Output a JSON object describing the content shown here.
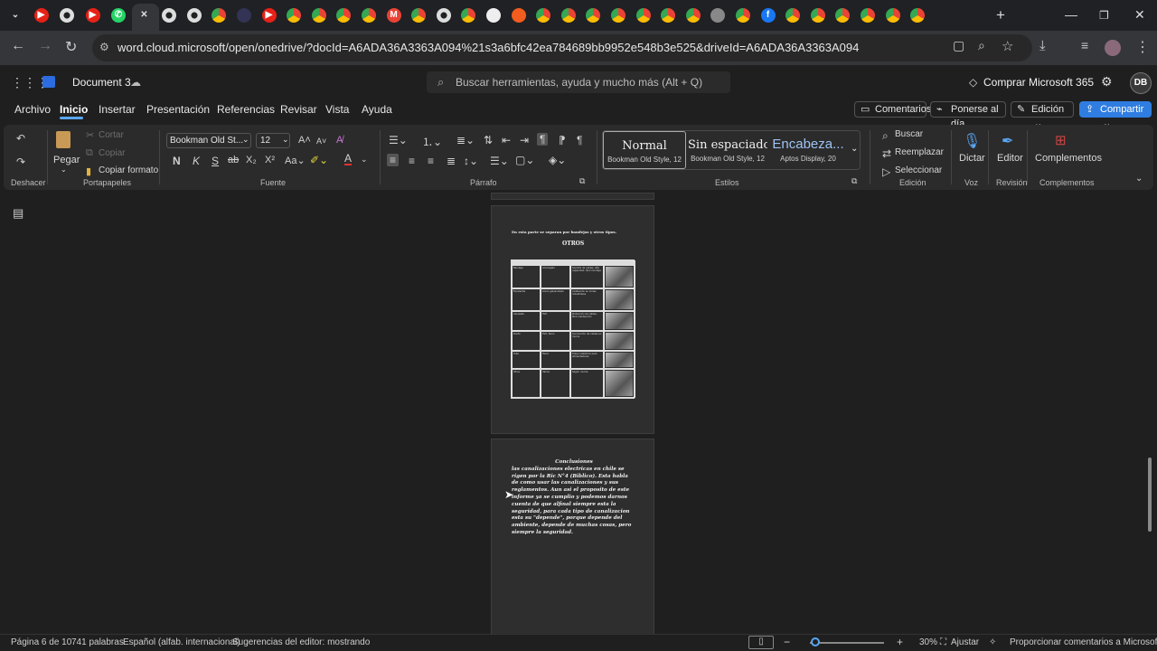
{
  "browser": {
    "url": "word.cloud.microsoft/open/onedrive/?docId=A6ADA36A3363A094%21s3a6bfc42ea784689bb9952e548b3e525&driveId=A6ADA36A3363A094",
    "new_tab": "+",
    "tab_icons": [
      "chevron-down-icon",
      "youtube-icon",
      "chatgpt-icon",
      "youtube-icon",
      "whatsapp-icon",
      "close-icon",
      "chatgpt-icon",
      "chatgpt-icon",
      "chrome-icon",
      "bcc-icon",
      "youtube-icon",
      "chrome-icon",
      "chrome-icon",
      "chrome-icon",
      "chrome-icon",
      "gmail-icon",
      "chrome-icon",
      "chatgpt-icon",
      "chrome-icon",
      "page-icon",
      "brave-icon",
      "chrome-icon",
      "chrome-icon",
      "chrome-icon",
      "chrome-icon",
      "chrome-icon",
      "chrome-icon",
      "chrome-icon",
      "globe-icon",
      "chrome-icon",
      "facebook-icon",
      "chrome-icon",
      "chrome-icon",
      "chrome-icon",
      "chrome-icon",
      "chrome-icon",
      "chrome-icon"
    ]
  },
  "word": {
    "doc_title": "Document 3",
    "search_placeholder": "Buscar herramientas, ayuda y mucho más (Alt + Q)",
    "buy_label": "Comprar Microsoft 365",
    "avatar": "DB",
    "menu": [
      "Archivo",
      "Inicio",
      "Insertar",
      "Presentación",
      "Referencias",
      "Revisar",
      "Vista",
      "Ayuda"
    ],
    "comments_btn": "Comentarios",
    "catchup_btn": "Ponerse al día",
    "edit_btn": "Edición",
    "share_btn": "Compartir"
  },
  "ribbon": {
    "undo_group": "Deshacer",
    "paste": "Pegar",
    "cut": "Cortar",
    "copy": "Copiar",
    "format_painter": "Copiar formato",
    "clipboard_group": "Portapapeles",
    "font_name": "Bookman Old St...",
    "font_size": "12",
    "bold": "N",
    "italic": "K",
    "underline": "S",
    "strike": "ab",
    "sub": "X₂",
    "sup": "X²",
    "font_group": "Fuente",
    "para_group": "Párrafo",
    "styles": [
      {
        "name": "Normal",
        "sub": "Bookman Old Style, 12"
      },
      {
        "name": "Sin espaciado",
        "sub": "Bookman Old Style, 12"
      },
      {
        "name": "Encabeza...",
        "sub": "Aptos Display, 20"
      }
    ],
    "styles_group": "Estilos",
    "find": "Buscar",
    "replace": "Reemplazar",
    "select": "Seleccionar",
    "edit_group": "Edición",
    "dictate": "Dictar",
    "voice_group": "Voz",
    "editor": "Editor",
    "review_group": "Revisión",
    "addins": "Complementos",
    "addins_group": "Complementos"
  },
  "document": {
    "page1_intro": "En esta parte se separan por bandejas y otros tipos.",
    "page1_heading": "OTROS",
    "table_rows": [
      [
        "Canalización",
        "Tipo/material",
        "Características",
        ""
      ],
      [
        "Bandeja",
        "Acero/galv.",
        "Soporte de cables, alta capacidad, fácil montaje",
        ""
      ],
      [
        "Escalerilla",
        "Acero galvanizado",
        "Instalación en zonas industriales",
        ""
      ],
      [
        "Canaleta",
        "PVC",
        "Protección de cables, fácil mantención",
        ""
      ],
      [
        "Ducto",
        "PVC, fierro",
        "Conducción de cables en muros",
        ""
      ],
      [
        "Tubo",
        "Fierro",
        "Tubos metálicos para alimentadores",
        ""
      ],
      [
        "Otros",
        "Varios",
        "Según norma",
        ""
      ]
    ],
    "conclusion_title": "Conclusiones",
    "conclusion_body": "las canalizaciones electricas en chile se rigen por la Ric N°4 (Biblico). Esta habla de como usar las canalizaciones y sus reglamentos. Aun asi el proposito de este informe ya se cumplio y podemos darnos cuenta de que alfinal siempre esta la seguridad, para cada tipo de canalizacion esta su \"depende\", porque depende del ambiente, depende de muchas cosas, pero siempre la seguridad."
  },
  "status": {
    "page": "Página 6 de 10",
    "words": "741 palabras",
    "language": "Español (alfab. internacional)",
    "suggestions": "Sugerencias del editor: mostrando",
    "zoom": "30%",
    "zoom_fraction": 0.05,
    "fit": "Ajustar",
    "feedback": "Proporcionar comentarios a Microsoft"
  }
}
